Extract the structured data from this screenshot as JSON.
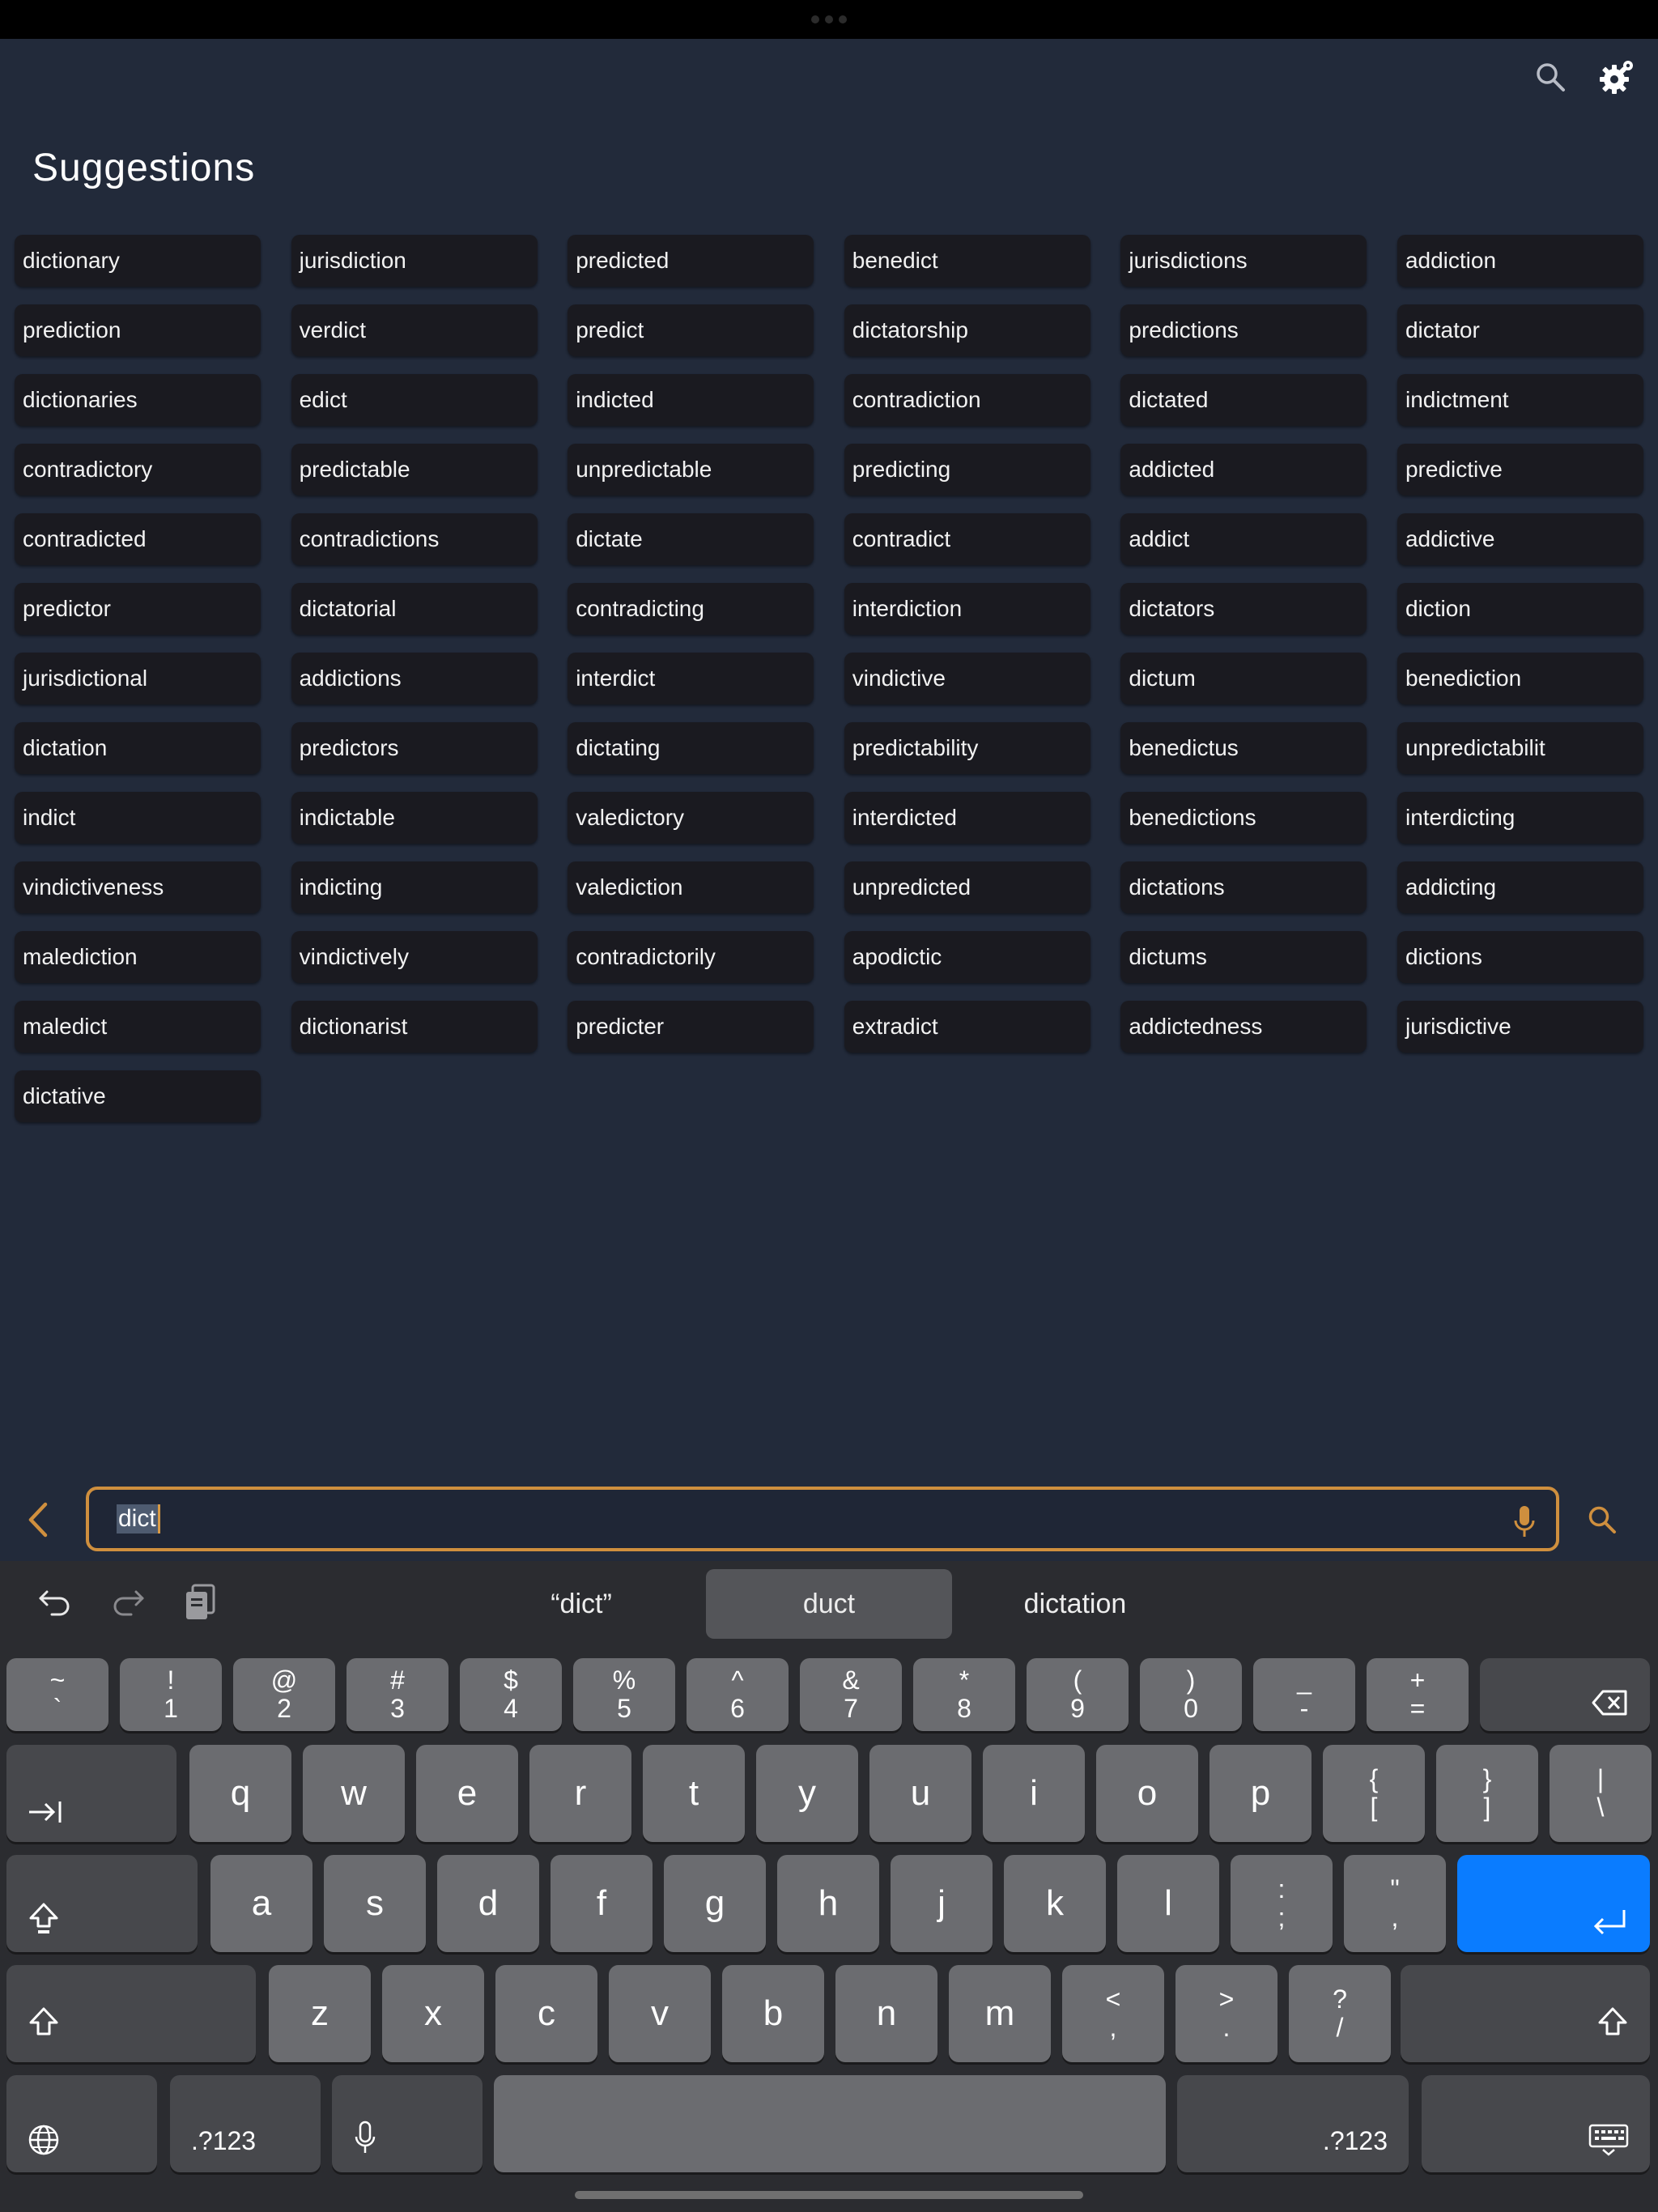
{
  "header": {
    "title": "Suggestions"
  },
  "suggestions": [
    "dictionary",
    "jurisdiction",
    "predicted",
    "benedict",
    "jurisdictions",
    "addiction",
    "prediction",
    "verdict",
    "predict",
    "dictatorship",
    "predictions",
    "dictator",
    "dictionaries",
    "edict",
    "indicted",
    "contradiction",
    "dictated",
    "indictment",
    "contradictory",
    "predictable",
    "unpredictable",
    "predicting",
    "addicted",
    "predictive",
    "contradicted",
    "contradictions",
    "dictate",
    "contradict",
    "addict",
    "addictive",
    "predictor",
    "dictatorial",
    "contradicting",
    "interdiction",
    "dictators",
    "diction",
    "jurisdictional",
    "addictions",
    "interdict",
    "vindictive",
    "dictum",
    "benediction",
    "dictation",
    "predictors",
    "dictating",
    "predictability",
    "benedictus",
    "unpredictabilit",
    "indict",
    "indictable",
    "valedictory",
    "interdicted",
    "benedictions",
    "interdicting",
    "vindictiveness",
    "indicting",
    "valediction",
    "unpredicted",
    "dictations",
    "addicting",
    "malediction",
    "vindictively",
    "contradictorily",
    "apodictic",
    "dictums",
    "dictions",
    "maledict",
    "dictionarist",
    "predicter",
    "extradict",
    "addictedness",
    "jurisdictive",
    "dictative"
  ],
  "search": {
    "value": "dict"
  },
  "keyboard": {
    "predictions": [
      {
        "label": "“dict”",
        "selected": false
      },
      {
        "label": "duct",
        "selected": true
      },
      {
        "label": "dictation",
        "selected": false
      }
    ],
    "number_row": [
      {
        "top": "~",
        "bottom": "`"
      },
      {
        "top": "!",
        "bottom": "1"
      },
      {
        "top": "@",
        "bottom": "2"
      },
      {
        "top": "#",
        "bottom": "3"
      },
      {
        "top": "$",
        "bottom": "4"
      },
      {
        "top": "%",
        "bottom": "5"
      },
      {
        "top": "^",
        "bottom": "6"
      },
      {
        "top": "&",
        "bottom": "7"
      },
      {
        "top": "*",
        "bottom": "8"
      },
      {
        "top": "(",
        "bottom": "9"
      },
      {
        "top": ")",
        "bottom": "0"
      },
      {
        "top": "_",
        "bottom": "-"
      },
      {
        "top": "+",
        "bottom": "="
      }
    ],
    "row_q": [
      "q",
      "w",
      "e",
      "r",
      "t",
      "y",
      "u",
      "i",
      "o",
      "p"
    ],
    "row_q_symbols": [
      {
        "top": "{",
        "bottom": "["
      },
      {
        "top": "}",
        "bottom": "]"
      },
      {
        "top": "|",
        "bottom": "\\"
      }
    ],
    "row_a": [
      "a",
      "s",
      "d",
      "f",
      "g",
      "h",
      "j",
      "k",
      "l"
    ],
    "row_a_symbols": [
      {
        "top": ":",
        "bottom": ";"
      },
      {
        "top": "\"",
        "bottom": ","
      }
    ],
    "row_z": [
      "z",
      "x",
      "c",
      "v",
      "b",
      "n",
      "m"
    ],
    "row_z_symbols": [
      {
        "top": "<",
        "bottom": ","
      },
      {
        "top": ">",
        "bottom": "."
      },
      {
        "top": "?",
        "bottom": "/"
      }
    ],
    "numbers_label_left": ".?123",
    "numbers_label_right": ".?123"
  },
  "colors": {
    "accent": "#cf8f3e",
    "return_key": "#0a7cff",
    "background": "#222a3a",
    "chip": "#1a1a20"
  }
}
